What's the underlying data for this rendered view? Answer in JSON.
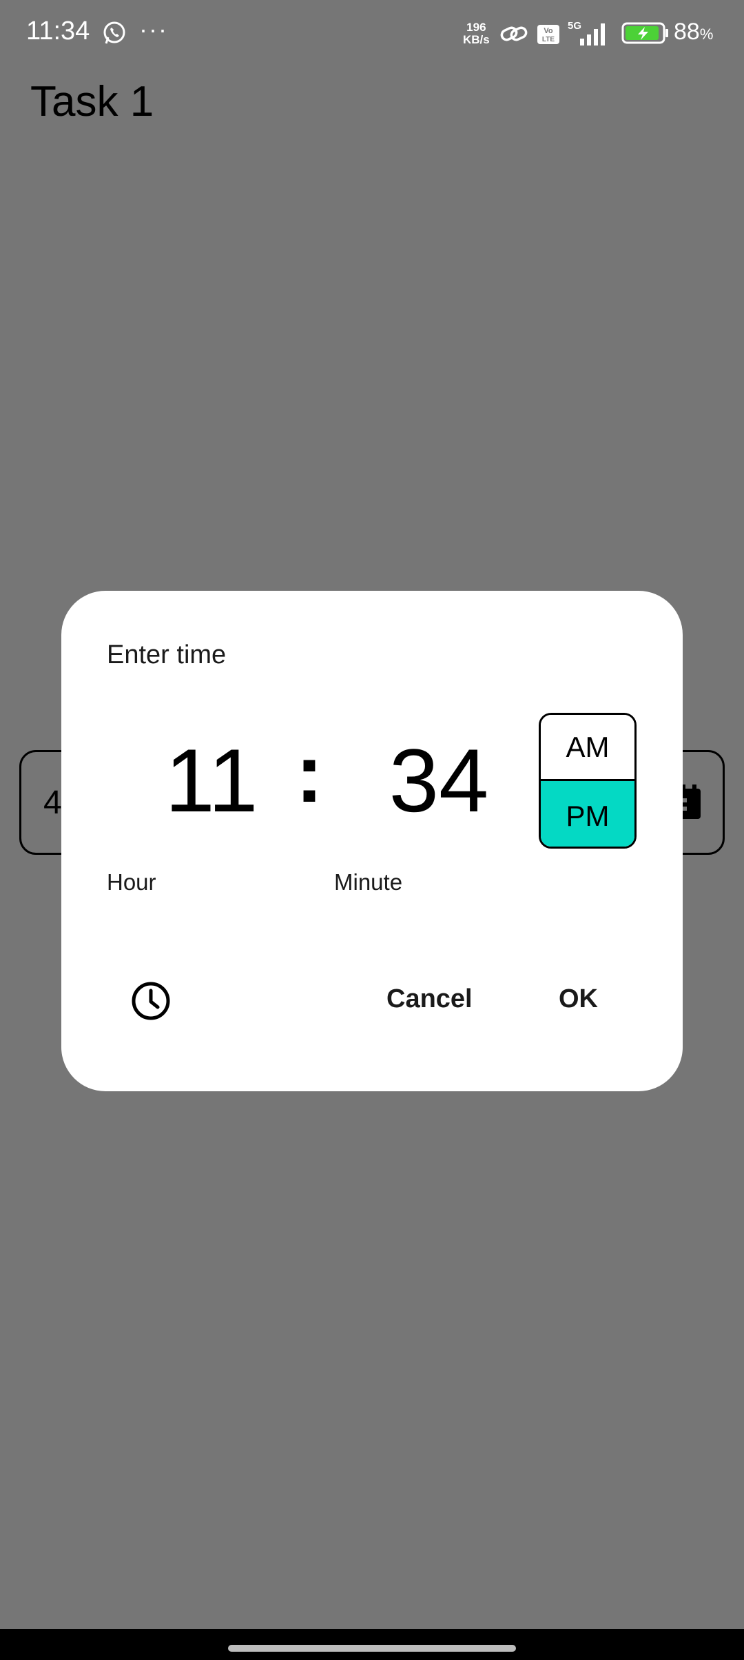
{
  "status_bar": {
    "time": "11:34",
    "more": "···",
    "net_speed_value": "196",
    "net_speed_unit": "KB/s",
    "volte": "Vo LTE",
    "network": "5G",
    "battery_percent": "88",
    "battery_unit": "%",
    "icons": [
      "whatsapp-icon",
      "link-icon",
      "volte-icon",
      "signal-icon",
      "battery-charging-icon"
    ]
  },
  "app": {
    "title": "Task 1",
    "field_text": "4",
    "field_icon": "calendar-icon"
  },
  "dialog": {
    "title": "Enter time",
    "hour": "11",
    "separator": ":",
    "minute": "34",
    "am_label": "AM",
    "pm_label": "PM",
    "selected_period": "PM",
    "hour_label": "Hour",
    "minute_label": "Minute",
    "mode_icon": "clock-icon",
    "cancel_label": "Cancel",
    "ok_label": "OK"
  },
  "colors": {
    "scrim": "#767676",
    "dialog_bg": "#ffffff",
    "selected_period_bg": "#04d9c4"
  }
}
